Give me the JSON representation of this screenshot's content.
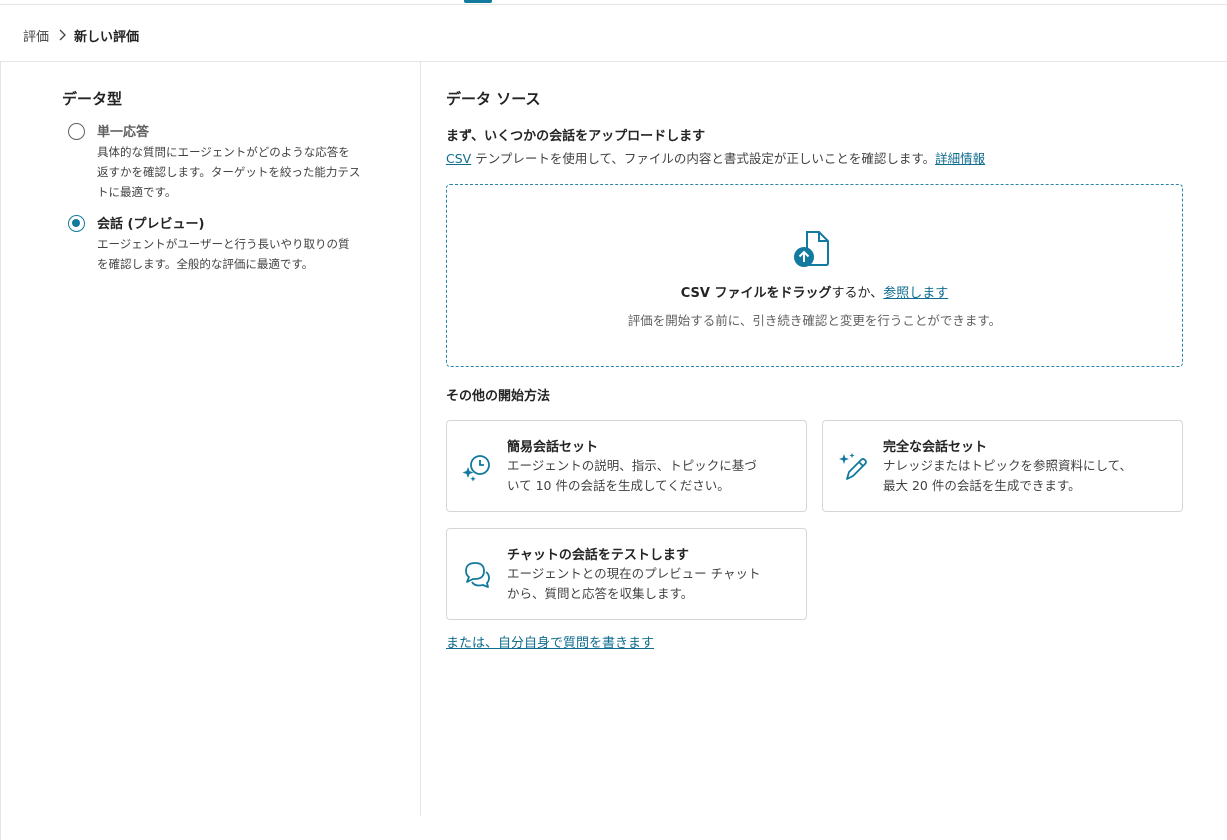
{
  "breadcrumb": {
    "parent": "評価",
    "current": "新しい評価"
  },
  "data_type": {
    "title": "データ型",
    "options": [
      {
        "label": "単一応答",
        "selected": false,
        "desc_lines": [
          "具体的な質問にエージェントがどのような応答を",
          "返すかを確認します。ターゲットを絞った能力テス",
          "トに最適です。"
        ]
      },
      {
        "label": "会話 (プレビュー)",
        "selected": true,
        "desc_lines": [
          "エージェントがユーザーと行う長いやり取りの質",
          "を確認します。全般的な評価に最適です。"
        ]
      }
    ]
  },
  "data_source": {
    "title": "データ ソース",
    "upload_title": "まず、いくつかの会話をアップロードします",
    "upload_desc": {
      "csv_link": "CSV",
      "text": " テンプレートを使用して、ファイルの内容と書式設定が正しいことを確認します。",
      "more_link": "詳細情報"
    },
    "dropzone": {
      "bold": "CSV ファイルをドラッグ",
      "middle": "するか、",
      "browse_link": "参照します",
      "sub": "評価を開始する前に、引き続き確認と変更を行うことができます。"
    },
    "other_title": "その他の開始方法",
    "cards": [
      {
        "icon": "sparkle-clock-icon",
        "title": "簡易会話セット",
        "desc_lines": [
          "エージェントの説明、指示、トピックに基づ",
          "いて 10 件の会話を生成してください。"
        ]
      },
      {
        "icon": "sparkle-pen-icon",
        "title": "完全な会話セット",
        "desc_lines": [
          "ナレッジまたはトピックを参照資料にして、",
          "最大 20 件の会話を生成できます。"
        ]
      },
      {
        "icon": "chat-bubbles-icon",
        "title": "チャットの会話をテストします",
        "desc_lines": [
          "エージェントとの現在のプレビュー チャット",
          "から、質問と応答を収集します。"
        ]
      }
    ],
    "own_link": "または、自分自身で質問を書きます"
  },
  "colors": {
    "accent": "#117a9e",
    "link": "#0f6c8e",
    "border": "#d6d6d6"
  }
}
